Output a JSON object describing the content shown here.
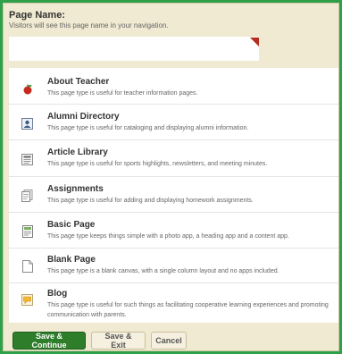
{
  "header": {
    "title": "Page Name:",
    "subtitle": "Visitors will see this page name in your navigation."
  },
  "name_input": {
    "value": "",
    "placeholder": ""
  },
  "page_types": [
    {
      "title": "About Teacher",
      "description": "This page type is useful for teacher information pages.",
      "icon": "apple-icon"
    },
    {
      "title": "Alumni Directory",
      "description": "This page type is useful for cataloging and displaying alumni information.",
      "icon": "person-card-icon"
    },
    {
      "title": "Article Library",
      "description": "This page type is useful for sports highlights, newsletters, and meeting minutes.",
      "icon": "newspaper-icon"
    },
    {
      "title": "Assignments",
      "description": "This page type is useful for adding and displaying homework assignments.",
      "icon": "document-stack-icon"
    },
    {
      "title": "Basic Page",
      "description": "This page type keeps things simple with a photo app, a heading app and a content app.",
      "icon": "page-layout-icon"
    },
    {
      "title": "Blank Page",
      "description": "This page type is a blank canvas, with a single column layout and no apps included.",
      "icon": "blank-page-icon"
    },
    {
      "title": "Blog",
      "description": "This page type is useful for such things as facilitating cooperative learning experiences and promoting communication with parents.",
      "icon": "speech-bubble-icon"
    }
  ],
  "footer": {
    "save_continue": "Save & Continue",
    "save_exit": "Save & Exit",
    "cancel": "Cancel"
  },
  "colors": {
    "background": "#2fa04a",
    "panel": "#f0ead2",
    "primary_button": "#2e7d2a",
    "input_flag": "#b32e1d"
  }
}
